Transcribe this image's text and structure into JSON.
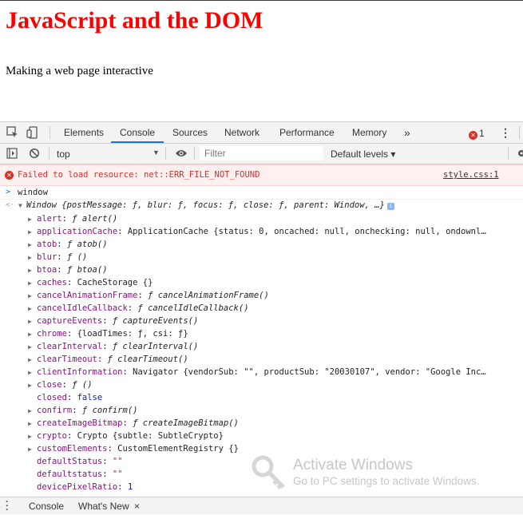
{
  "page": {
    "heading": "JavaScript and the DOM",
    "text": "Making a web page interactive"
  },
  "devtools": {
    "tabs": [
      "Elements",
      "Console",
      "Sources",
      "Network",
      "Performance",
      "Memory"
    ],
    "active_tab": "Console",
    "more_tabs": "»",
    "error_count": "1",
    "menu_icon": "⋮",
    "close_icon": "×",
    "toolbar": {
      "context": "top",
      "filter_placeholder": "Filter",
      "levels": "Default levels ▾"
    },
    "console": {
      "error": {
        "message": "Failed to load resource: net::ERR_FILE_NOT_FOUND",
        "source": "style.css:1"
      },
      "input": "window",
      "output_summary": "Window {postMessage: ƒ, blur: ƒ, focus: ƒ, close: ƒ, parent: Window, …}",
      "info_badge": "i",
      "properties": [
        {
          "key": "alert",
          "value": "ƒ alert()",
          "kind": "fn",
          "expandable": true
        },
        {
          "key": "applicationCache",
          "value": "ApplicationCache {status: 0, oncached: null, onchecking: null, ondownl…",
          "kind": "obj",
          "expandable": true
        },
        {
          "key": "atob",
          "value": "ƒ atob()",
          "kind": "fn",
          "expandable": true
        },
        {
          "key": "blur",
          "value": "ƒ ()",
          "kind": "fn",
          "expandable": true
        },
        {
          "key": "btoa",
          "value": "ƒ btoa()",
          "kind": "fn",
          "expandable": true
        },
        {
          "key": "caches",
          "value": "CacheStorage {}",
          "kind": "obj",
          "expandable": true
        },
        {
          "key": "cancelAnimationFrame",
          "value": "ƒ cancelAnimationFrame()",
          "kind": "fn",
          "expandable": true
        },
        {
          "key": "cancelIdleCallback",
          "value": "ƒ cancelIdleCallback()",
          "kind": "fn",
          "expandable": true
        },
        {
          "key": "captureEvents",
          "value": "ƒ captureEvents()",
          "kind": "fn",
          "expandable": true
        },
        {
          "key": "chrome",
          "value": "{loadTimes: ƒ, csi: ƒ}",
          "kind": "obj",
          "expandable": true
        },
        {
          "key": "clearInterval",
          "value": "ƒ clearInterval()",
          "kind": "fn",
          "expandable": true
        },
        {
          "key": "clearTimeout",
          "value": "ƒ clearTimeout()",
          "kind": "fn",
          "expandable": true
        },
        {
          "key": "clientInformation",
          "value": "Navigator {vendorSub: \"\", productSub: \"20030107\", vendor: \"Google Inc…",
          "kind": "obj",
          "expandable": true
        },
        {
          "key": "close",
          "value": "ƒ ()",
          "kind": "fn",
          "expandable": true
        },
        {
          "key": "closed",
          "value": "false",
          "kind": "kw",
          "expandable": false
        },
        {
          "key": "confirm",
          "value": "ƒ confirm()",
          "kind": "fn",
          "expandable": true
        },
        {
          "key": "createImageBitmap",
          "value": "ƒ createImageBitmap()",
          "kind": "fn",
          "expandable": true
        },
        {
          "key": "crypto",
          "value": "Crypto {subtle: SubtleCrypto}",
          "kind": "obj",
          "expandable": true
        },
        {
          "key": "customElements",
          "value": "CustomElementRegistry {}",
          "kind": "obj",
          "expandable": true
        },
        {
          "key": "defaultStatus",
          "value": "\"\"",
          "kind": "str",
          "expandable": false
        },
        {
          "key": "defaultstatus",
          "value": "\"\"",
          "kind": "str",
          "expandable": false
        },
        {
          "key": "devicePixelRatio",
          "value": "1",
          "kind": "num",
          "expandable": false
        }
      ]
    },
    "drawer": {
      "menu_icon": "⋮",
      "tabs": [
        "Console",
        "What's New"
      ],
      "close_icon": "×"
    }
  },
  "watermark": {
    "title": "Activate Windows",
    "subtitle": "Go to PC settings to activate Windows."
  }
}
